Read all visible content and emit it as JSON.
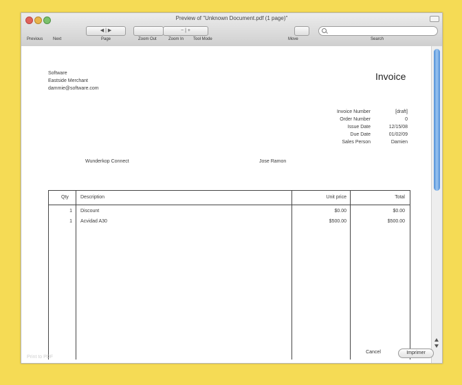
{
  "window": {
    "title": "Preview of \"Unknown Document.pdf (1 page)\"",
    "toolbar_labels": [
      "Previous",
      "Next",
      "Page",
      "Zoom Out",
      "Zoom In",
      "Tool Mode",
      "Move",
      "Search"
    ],
    "footer_text": "Print to PDF",
    "buttons": {
      "cancel": "Cancel",
      "print": "Imprimer"
    }
  },
  "invoice": {
    "title": "Invoice",
    "seller": [
      "Software",
      "Eastside Merchant",
      "dammie@software.com"
    ],
    "meta": [
      {
        "label": "Invoice Number",
        "value": "[draft]"
      },
      {
        "label": "Order Number",
        "value": "0"
      },
      {
        "label": "Issue Date",
        "value": "12/15/08"
      },
      {
        "label": "Due Date",
        "value": "01/02/09"
      },
      {
        "label": "Sales Person",
        "value": "Damien"
      }
    ],
    "bill_to": "Wunderkop Connect",
    "contact": "Jose Ramon",
    "columns": [
      "Qty",
      "Description",
      "Unit price",
      "Total"
    ],
    "rows": [
      {
        "qty": "1",
        "description": "Discount",
        "unit_price": "$0.00",
        "total": "$0.00"
      },
      {
        "qty": "1",
        "description": "Acvidad A30",
        "unit_price": "$500.00",
        "total": "$500.00"
      }
    ]
  },
  "colors": {
    "frame": "#f5db55",
    "scroll_thumb": "#4f8fd8"
  }
}
